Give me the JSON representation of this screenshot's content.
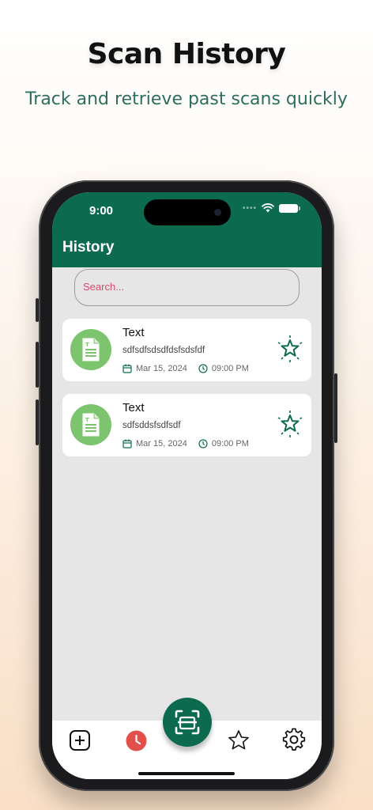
{
  "promo": {
    "title": "Scan History",
    "subtitle": "Track and retrieve past scans quickly"
  },
  "status_bar": {
    "time": "9:00",
    "signal": "••••"
  },
  "header": {
    "title": "History",
    "color": "#0c6b4e"
  },
  "search": {
    "placeholder": "Search..."
  },
  "history_items": [
    {
      "title": "Text",
      "content": "sdfsdfsdsdfdsfsdsfdf",
      "date": "Mar 15, 2024",
      "time": "09:00 PM",
      "icon": "document-icon",
      "favorite_icon": "star-icon"
    },
    {
      "title": "Text",
      "content": "sdfsddsfsdfsdf",
      "date": "Mar 15, 2024",
      "time": "09:00 PM",
      "icon": "document-icon",
      "favorite_icon": "star-icon"
    }
  ],
  "bottom_nav": {
    "items": [
      {
        "name": "create",
        "icon": "plus-square-icon"
      },
      {
        "name": "history",
        "icon": "clock-icon",
        "active_color": "#e2504b"
      },
      {
        "name": "scan",
        "icon": "scan-icon"
      },
      {
        "name": "favorites",
        "icon": "star-icon"
      },
      {
        "name": "settings",
        "icon": "gear-icon"
      }
    ]
  }
}
